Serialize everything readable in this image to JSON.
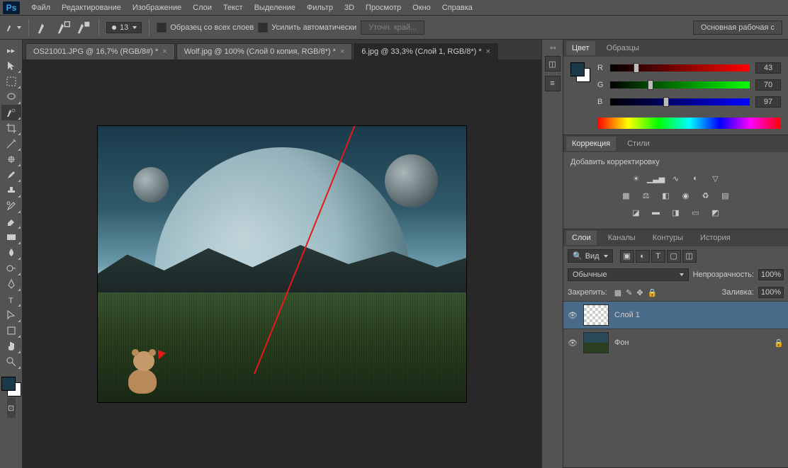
{
  "app_logo": "Ps",
  "menu": [
    "Файл",
    "Редактирование",
    "Изображение",
    "Слои",
    "Текст",
    "Выделение",
    "Фильтр",
    "3D",
    "Просмотр",
    "Окно",
    "Справка"
  ],
  "options": {
    "brush_size": "13",
    "chk1": "Образец со всех слоев",
    "chk2": "Усилить автоматически",
    "refine": "Уточн. край...",
    "workspace": "Основная рабочая с"
  },
  "tabs": [
    {
      "label": "OS21001.JPG @ 16,7% (RGB/8#) *",
      "active": false
    },
    {
      "label": "Wolf.jpg @ 100% (Слой 0 копия, RGB/8*) *",
      "active": false
    },
    {
      "label": "6.jpg @ 33,3% (Слой 1, RGB/8*) *",
      "active": true
    }
  ],
  "color_panel": {
    "tabs": [
      "Цвет",
      "Образцы"
    ],
    "r": {
      "label": "R",
      "val": "43",
      "pct": 17
    },
    "g": {
      "label": "G",
      "val": "70",
      "pct": 27
    },
    "b": {
      "label": "B",
      "val": "97",
      "pct": 38
    }
  },
  "adjust_panel": {
    "tabs": [
      "Коррекция",
      "Стили"
    ],
    "hint": "Добавить корректировку"
  },
  "layers_panel": {
    "tabs": [
      "Слои",
      "Каналы",
      "Контуры",
      "История"
    ],
    "search_label": "Вид",
    "blend": "Обычные",
    "opacity_label": "Непрозрачность:",
    "opacity_val": "100%",
    "lock_label": "Закрепить:",
    "fill_label": "Заливка:",
    "fill_val": "100%",
    "layers": [
      {
        "name": "Слой 1",
        "sel": true,
        "thumb": "transparent"
      },
      {
        "name": "Фон",
        "sel": false,
        "thumb": "img",
        "locked": true
      }
    ]
  }
}
